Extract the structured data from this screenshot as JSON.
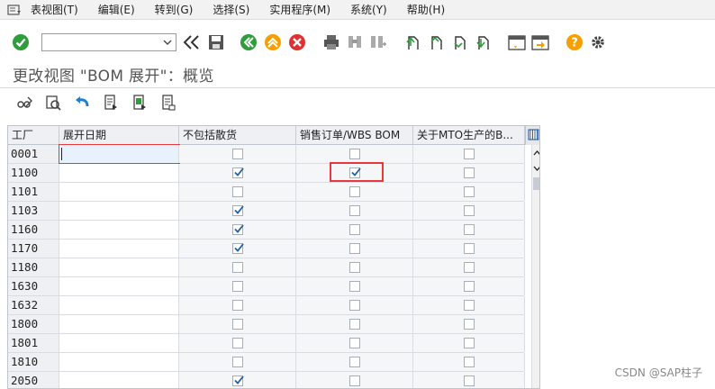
{
  "menu": {
    "items": [
      "表视图(T)",
      "编辑(E)",
      "转到(G)",
      "选择(S)",
      "实用程序(M)",
      "系统(Y)",
      "帮助(H)"
    ]
  },
  "toolbar": {
    "command_value": ""
  },
  "page_title": "更改视图 \"BOM 展开\"：概览",
  "table": {
    "columns": [
      "工厂",
      "展开日期",
      "不包括散货",
      "销售订单/WBS BOM",
      "关于MTO生产的B..."
    ],
    "rows": [
      {
        "plant": "0001",
        "date": "",
        "excl_bulk": false,
        "so_wbs": false,
        "mto": false
      },
      {
        "plant": "1100",
        "date": "",
        "excl_bulk": true,
        "so_wbs": true,
        "mto": false
      },
      {
        "plant": "1101",
        "date": "",
        "excl_bulk": false,
        "so_wbs": false,
        "mto": false
      },
      {
        "plant": "1103",
        "date": "",
        "excl_bulk": true,
        "so_wbs": false,
        "mto": false
      },
      {
        "plant": "1160",
        "date": "",
        "excl_bulk": true,
        "so_wbs": false,
        "mto": false
      },
      {
        "plant": "1170",
        "date": "",
        "excl_bulk": true,
        "so_wbs": false,
        "mto": false
      },
      {
        "plant": "1180",
        "date": "",
        "excl_bulk": false,
        "so_wbs": false,
        "mto": false
      },
      {
        "plant": "1630",
        "date": "",
        "excl_bulk": false,
        "so_wbs": false,
        "mto": false
      },
      {
        "plant": "1632",
        "date": "",
        "excl_bulk": false,
        "so_wbs": false,
        "mto": false
      },
      {
        "plant": "1800",
        "date": "",
        "excl_bulk": false,
        "so_wbs": false,
        "mto": false
      },
      {
        "plant": "1801",
        "date": "",
        "excl_bulk": false,
        "so_wbs": false,
        "mto": false
      },
      {
        "plant": "1810",
        "date": "",
        "excl_bulk": false,
        "so_wbs": false,
        "mto": false
      },
      {
        "plant": "2050",
        "date": "",
        "excl_bulk": true,
        "so_wbs": false,
        "mto": false
      }
    ]
  },
  "watermark": "CSDN @SAP柱子",
  "colors": {
    "accent_green": "#2e9d3a",
    "accent_orange": "#f5a000",
    "accent_red": "#e0302f",
    "accent_blue": "#1f7fd1",
    "highlight_red": "#e8383d"
  }
}
